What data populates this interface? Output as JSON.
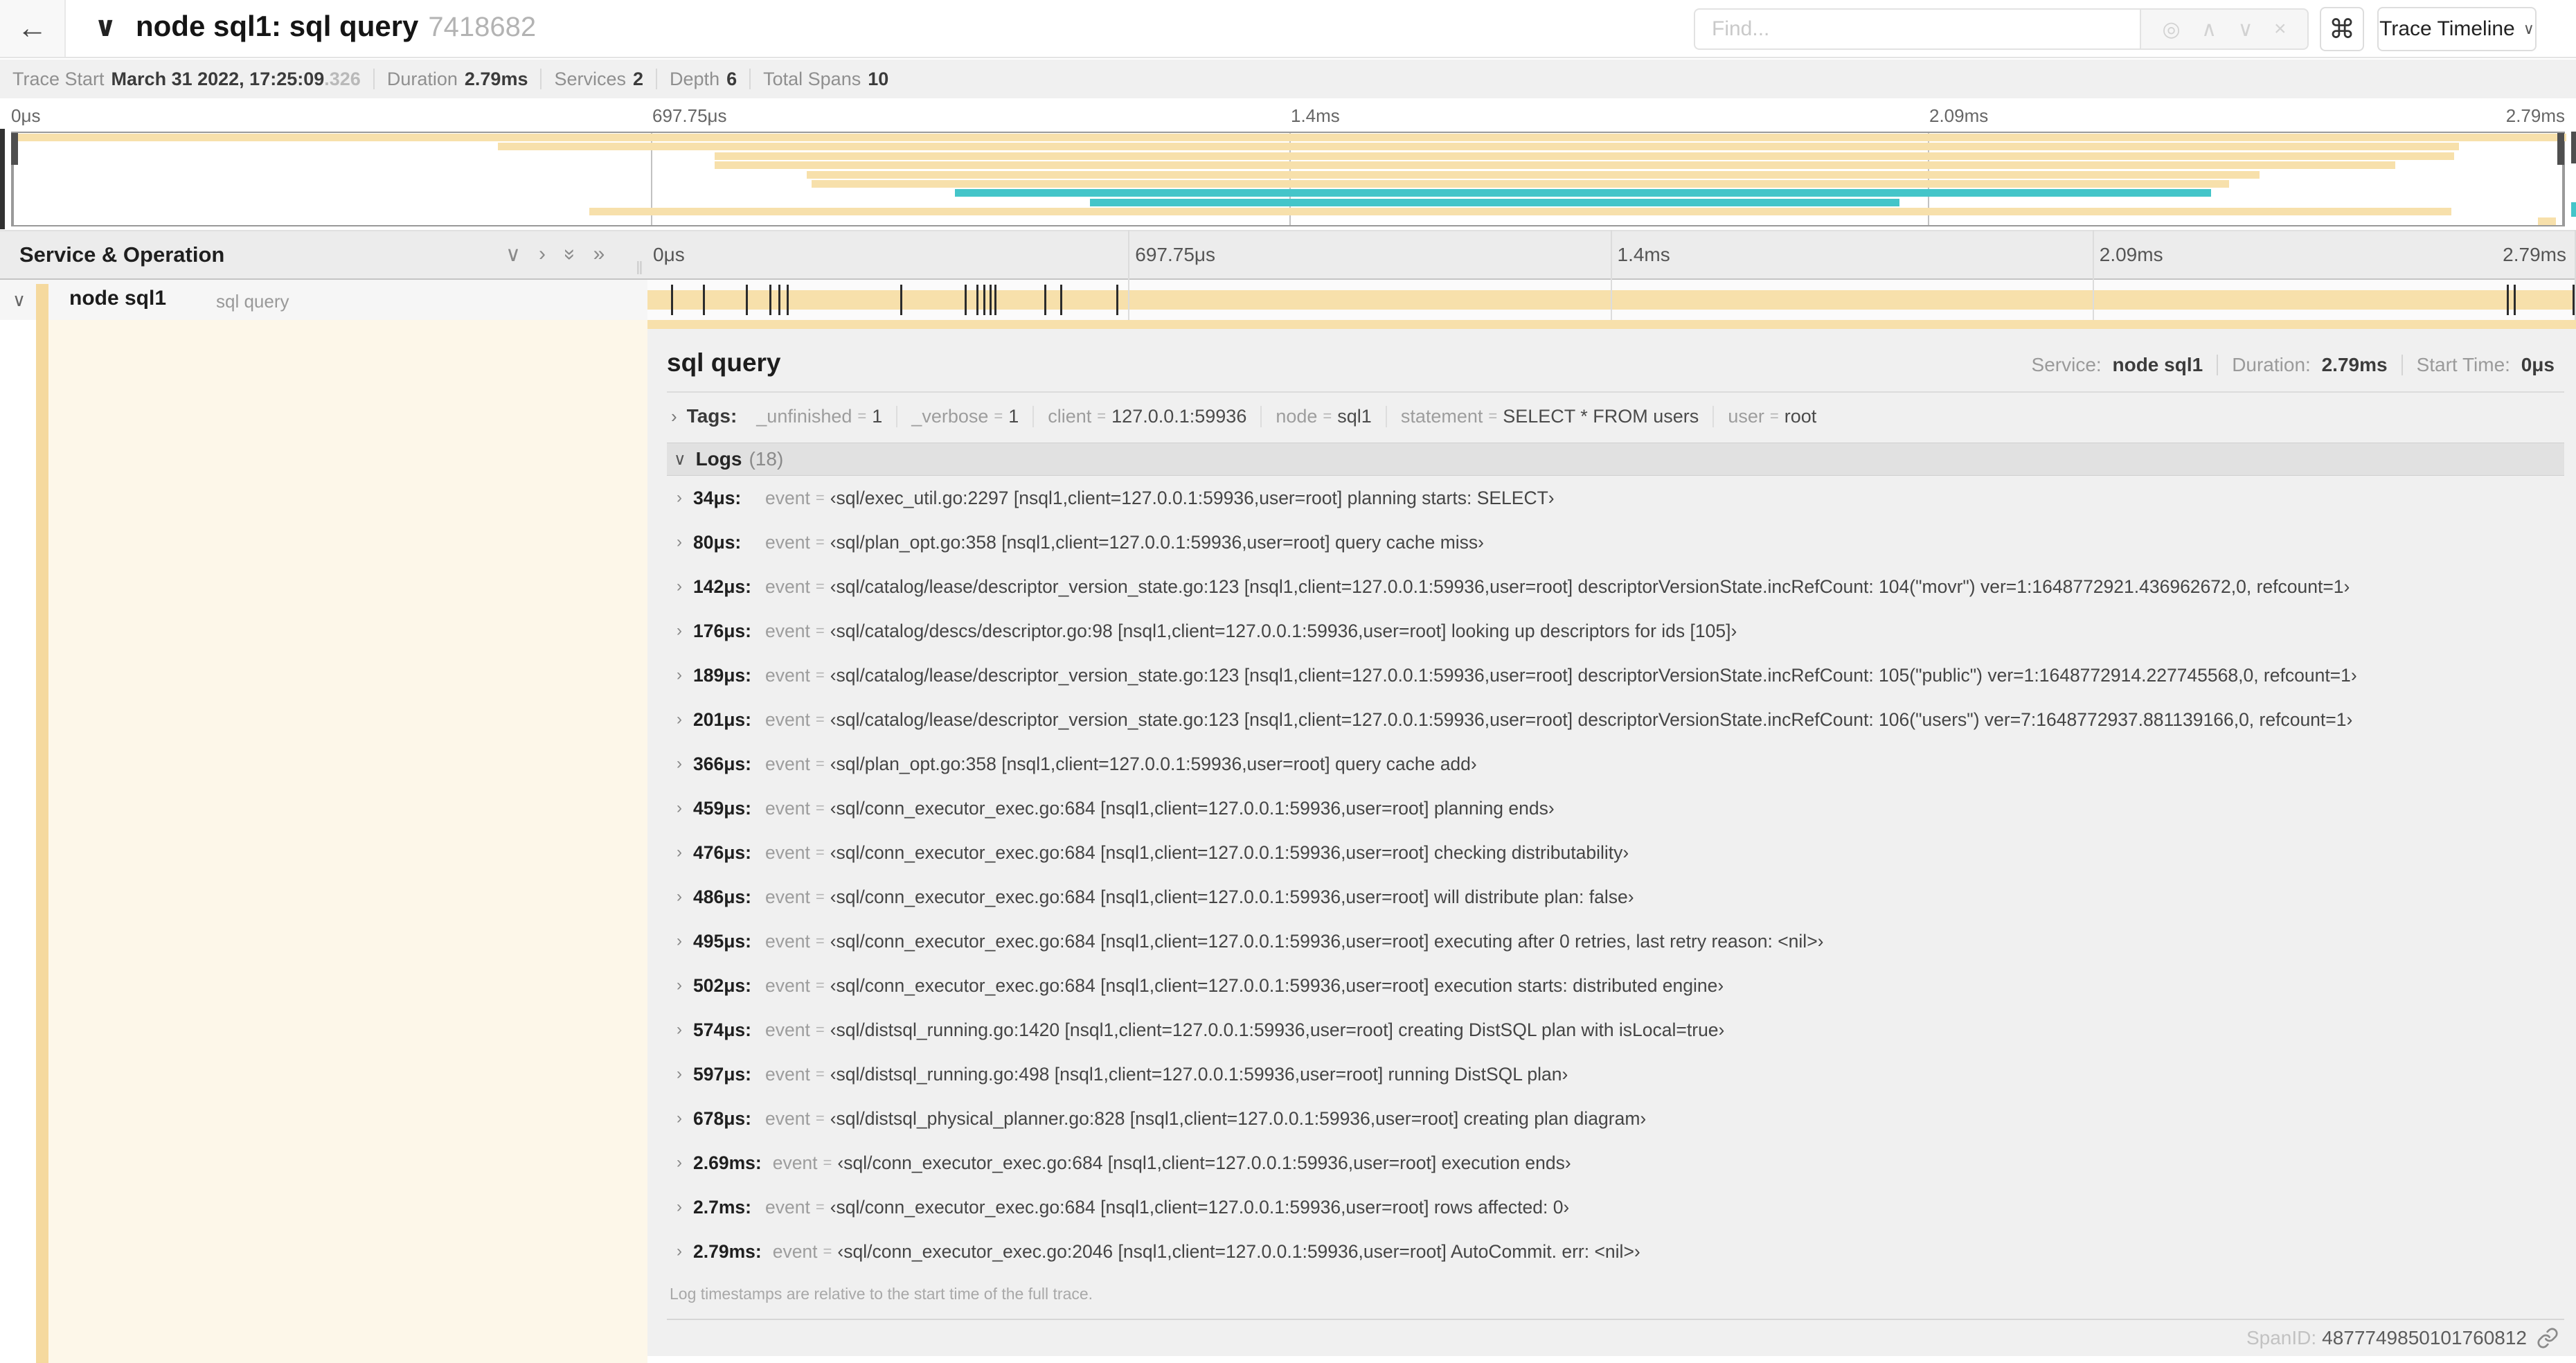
{
  "colors": {
    "tan": "#f7e0ab",
    "teal": "#44c5c9",
    "accent": "#f5d99e",
    "cream": "#fdf7e9"
  },
  "header": {
    "back_icon": "←",
    "collapse_icon": "∨",
    "title": "node sql1: sql query",
    "trace_id_short": "7418682",
    "find_placeholder": "Find...",
    "find_icons": [
      "◎",
      "∧",
      "∨",
      "×"
    ],
    "shortcut_icon": "⌘",
    "view_button_label": "Trace Timeline",
    "view_button_chevron": "∨"
  },
  "trace_info": [
    {
      "label": "Trace Start",
      "value": "March 31 2022, 17:25:09",
      "suffix": ".326"
    },
    {
      "label": "Duration",
      "value": "2.79ms"
    },
    {
      "label": "Services",
      "value": "2"
    },
    {
      "label": "Depth",
      "value": "6"
    },
    {
      "label": "Total Spans",
      "value": "10"
    }
  ],
  "timeline": {
    "duration_us": 2790,
    "ruler_ticks": [
      {
        "label": "0μs",
        "pct": 0
      },
      {
        "label": "697.75μs",
        "pct": 25
      },
      {
        "label": "1.4ms",
        "pct": 50
      },
      {
        "label": "2.09ms",
        "pct": 75
      },
      {
        "label": "2.79ms",
        "pct": 100
      }
    ]
  },
  "minimap": {
    "spans": [
      {
        "row": 0,
        "start_pct": 0,
        "end_pct": 100,
        "color": "tan"
      },
      {
        "row": 1,
        "start_pct": 19,
        "end_pct": 95.8,
        "color": "tan"
      },
      {
        "row": 2,
        "start_pct": 27.5,
        "end_pct": 95.6,
        "color": "tan"
      },
      {
        "row": 3,
        "start_pct": 27.5,
        "end_pct": 93.3,
        "color": "tan"
      },
      {
        "row": 4,
        "start_pct": 31.1,
        "end_pct": 88.0,
        "color": "tan"
      },
      {
        "row": 5,
        "start_pct": 31.3,
        "end_pct": 86.8,
        "color": "tan"
      },
      {
        "row": 6,
        "start_pct": 36.9,
        "end_pct": 86.1,
        "color": "teal"
      },
      {
        "row": 7,
        "start_pct": 42.2,
        "end_pct": 73.9,
        "color": "teal"
      },
      {
        "row": 8,
        "start_pct": 22.6,
        "end_pct": 95.5,
        "color": "tan"
      },
      {
        "row": 9,
        "start_pct": 98.9,
        "end_pct": 99.6,
        "color": "tan"
      }
    ]
  },
  "span_table": {
    "header": "Service & Operation",
    "icons": {
      "collapse_one": "∨",
      "expand_one": "›",
      "collapse_all": "»",
      "expand_all": "»"
    },
    "row": {
      "chevron": "∨",
      "service": "node sql1",
      "operation": "sql query"
    }
  },
  "detail": {
    "title": "sql query",
    "summary": [
      {
        "label": "Service:",
        "value": "node sql1"
      },
      {
        "label": "Duration:",
        "value": "2.79ms"
      },
      {
        "label": "Start Time:",
        "value": "0μs"
      }
    ],
    "tags_label": "Tags:",
    "tags": [
      {
        "key": "_unfinished",
        "value": "1"
      },
      {
        "key": "_verbose",
        "value": "1"
      },
      {
        "key": "client",
        "value": "127.0.0.1:59936"
      },
      {
        "key": "node",
        "value": "sql1"
      },
      {
        "key": "statement",
        "value": "SELECT * FROM users"
      },
      {
        "key": "user",
        "value": "root"
      }
    ],
    "logs_label": "Logs",
    "logs_count": "(18)",
    "logs": [
      {
        "t_us": 34,
        "time": "34μs:",
        "key": "event",
        "value": "‹sql/exec_util.go:2297 [nsql1,client=127.0.0.1:59936,user=root] planning starts: SELECT›"
      },
      {
        "t_us": 80,
        "time": "80μs:",
        "key": "event",
        "value": "‹sql/plan_opt.go:358 [nsql1,client=127.0.0.1:59936,user=root] query cache miss›"
      },
      {
        "t_us": 142,
        "time": "142μs:",
        "key": "event",
        "value": "‹sql/catalog/lease/descriptor_version_state.go:123 [nsql1,client=127.0.0.1:59936,user=root] descriptorVersionState.incRefCount: 104(\"movr\") ver=1:1648772921.436962672,0, refcount=1›"
      },
      {
        "t_us": 176,
        "time": "176μs:",
        "key": "event",
        "value": "‹sql/catalog/descs/descriptor.go:98 [nsql1,client=127.0.0.1:59936,user=root] looking up descriptors for ids [105]›"
      },
      {
        "t_us": 189,
        "time": "189μs:",
        "key": "event",
        "value": "‹sql/catalog/lease/descriptor_version_state.go:123 [nsql1,client=127.0.0.1:59936,user=root] descriptorVersionState.incRefCount: 105(\"public\") ver=1:1648772914.227745568,0, refcount=1›"
      },
      {
        "t_us": 201,
        "time": "201μs:",
        "key": "event",
        "value": "‹sql/catalog/lease/descriptor_version_state.go:123 [nsql1,client=127.0.0.1:59936,user=root] descriptorVersionState.incRefCount: 106(\"users\") ver=7:1648772937.881139166,0, refcount=1›"
      },
      {
        "t_us": 366,
        "time": "366μs:",
        "key": "event",
        "value": "‹sql/plan_opt.go:358 [nsql1,client=127.0.0.1:59936,user=root] query cache add›"
      },
      {
        "t_us": 459,
        "time": "459μs:",
        "key": "event",
        "value": "‹sql/conn_executor_exec.go:684 [nsql1,client=127.0.0.1:59936,user=root] planning ends›"
      },
      {
        "t_us": 476,
        "time": "476μs:",
        "key": "event",
        "value": "‹sql/conn_executor_exec.go:684 [nsql1,client=127.0.0.1:59936,user=root] checking distributability›"
      },
      {
        "t_us": 486,
        "time": "486μs:",
        "key": "event",
        "value": "‹sql/conn_executor_exec.go:684 [nsql1,client=127.0.0.1:59936,user=root] will distribute plan: false›"
      },
      {
        "t_us": 495,
        "time": "495μs:",
        "key": "event",
        "value": "‹sql/conn_executor_exec.go:684 [nsql1,client=127.0.0.1:59936,user=root] executing after 0 retries, last retry reason: <nil>›"
      },
      {
        "t_us": 502,
        "time": "502μs:",
        "key": "event",
        "value": "‹sql/conn_executor_exec.go:684 [nsql1,client=127.0.0.1:59936,user=root] execution starts: distributed engine›"
      },
      {
        "t_us": 574,
        "time": "574μs:",
        "key": "event",
        "value": "‹sql/distsql_running.go:1420 [nsql1,client=127.0.0.1:59936,user=root] creating DistSQL plan with isLocal=true›"
      },
      {
        "t_us": 597,
        "time": "597μs:",
        "key": "event",
        "value": "‹sql/distsql_running.go:498 [nsql1,client=127.0.0.1:59936,user=root] running DistSQL plan›"
      },
      {
        "t_us": 678,
        "time": "678μs:",
        "key": "event",
        "value": "‹sql/distsql_physical_planner.go:828 [nsql1,client=127.0.0.1:59936,user=root] creating plan diagram›"
      },
      {
        "t_us": 2690,
        "time": "2.69ms:",
        "key": "event",
        "value": "‹sql/conn_executor_exec.go:684 [nsql1,client=127.0.0.1:59936,user=root] execution ends›"
      },
      {
        "t_us": 2700,
        "time": "2.7ms:",
        "key": "event",
        "value": "‹sql/conn_executor_exec.go:684 [nsql1,client=127.0.0.1:59936,user=root] rows affected: 0›"
      },
      {
        "t_us": 2790,
        "time": "2.79ms:",
        "key": "event",
        "value": "‹sql/conn_executor_exec.go:2046 [nsql1,client=127.0.0.1:59936,user=root] AutoCommit. err: <nil>›"
      }
    ],
    "footer_note": "Log timestamps are relative to the start time of the full trace.",
    "span_id_label": "SpanID:",
    "span_id": "4877749850101760812"
  }
}
